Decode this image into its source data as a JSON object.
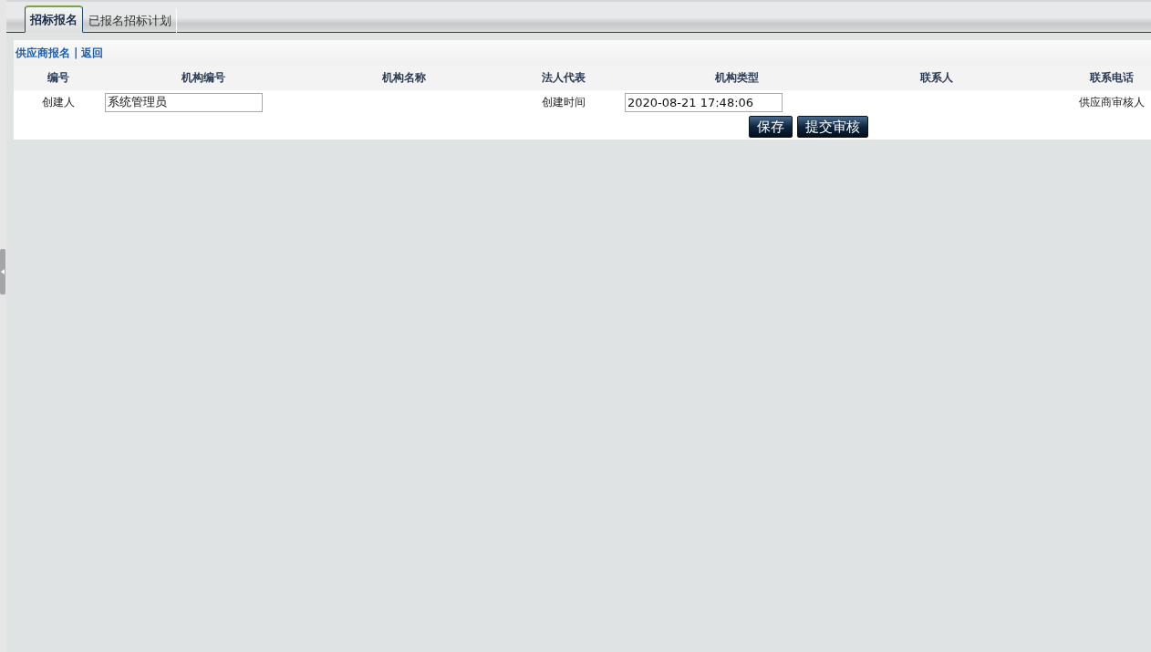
{
  "tabs": [
    {
      "label": "招标报名",
      "selected": true
    },
    {
      "label": "已报名招标计划",
      "selected": false
    }
  ],
  "breadcrumb": {
    "links": [
      "供应商报名",
      "返回"
    ],
    "separator": "|"
  },
  "table": {
    "columns": [
      "编号",
      "机构编号",
      "机构名称",
      "法人代表",
      "机构类型",
      "联系人",
      "联系电话"
    ],
    "rows": [
      [
        {
          "kind": "label",
          "text": "创建人"
        },
        {
          "kind": "input",
          "value": "系统管理员"
        },
        {
          "kind": "empty"
        },
        {
          "kind": "label",
          "text": "创建时间"
        },
        {
          "kind": "input",
          "value": "2020-08-21 17:48:06"
        },
        {
          "kind": "empty"
        },
        {
          "kind": "label",
          "text": "供应商审核人"
        }
      ]
    ]
  },
  "buttons": [
    "保存",
    "提交审核"
  ]
}
